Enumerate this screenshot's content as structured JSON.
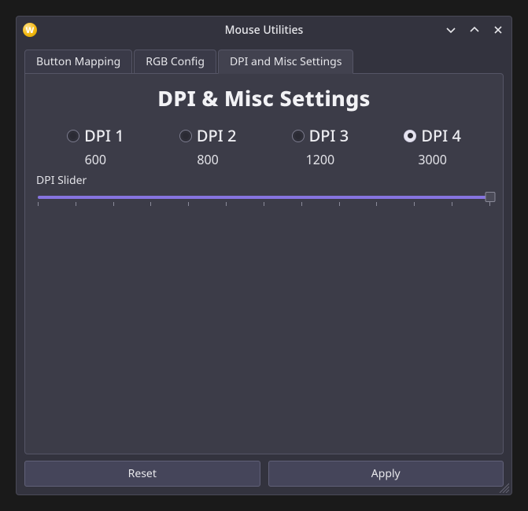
{
  "window": {
    "title": "Mouse Utilities",
    "app_icon_letter": "W"
  },
  "tabs": [
    {
      "label": "Button Mapping",
      "active": false
    },
    {
      "label": "RGB Config",
      "active": false
    },
    {
      "label": "DPI and Misc Settings",
      "active": true
    }
  ],
  "panel": {
    "heading": "DPI & Misc Settings",
    "dpi_options": [
      {
        "label": "DPI 1",
        "value": "600",
        "selected": false
      },
      {
        "label": "DPI 2",
        "value": "800",
        "selected": false
      },
      {
        "label": "DPI 3",
        "value": "1200",
        "selected": false
      },
      {
        "label": "DPI 4",
        "value": "3000",
        "selected": true
      }
    ],
    "slider": {
      "label": "DPI Slider",
      "min": 0,
      "max": 100,
      "value": 100,
      "tick_count": 13
    }
  },
  "buttons": {
    "reset": "Reset",
    "apply": "Apply"
  }
}
